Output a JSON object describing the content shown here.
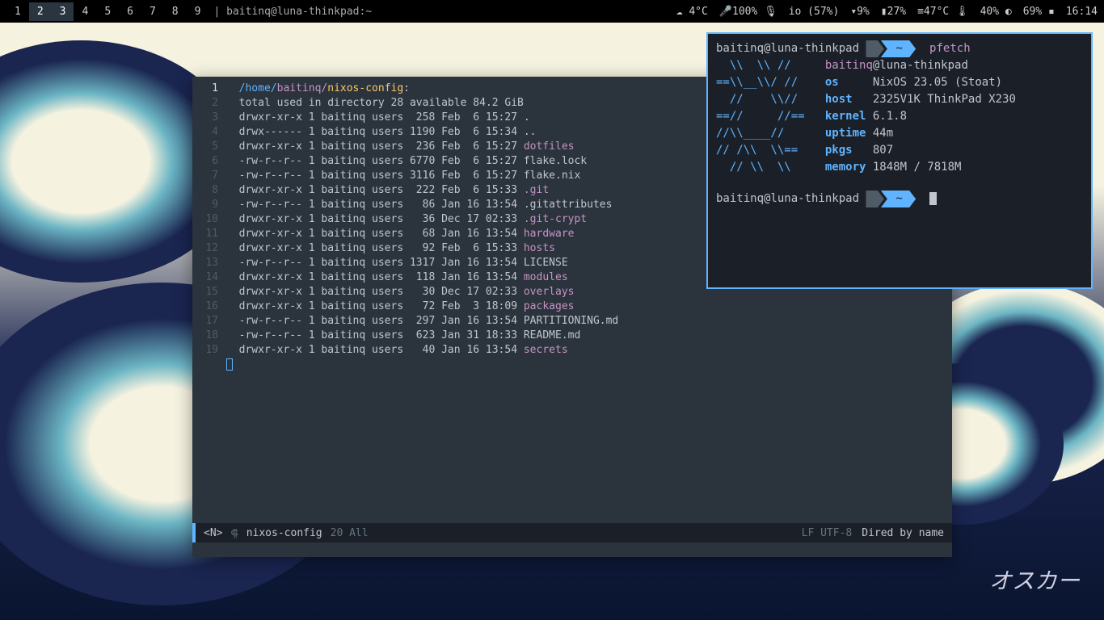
{
  "statusbar": {
    "workspaces": [
      "1",
      "2",
      "3",
      "4",
      "5",
      "6",
      "7",
      "8",
      "9"
    ],
    "active_workspaces": [
      1,
      2
    ],
    "title_prefix": "| ",
    "title": "baitinq@luna-thinkpad:~",
    "weather_icon": "☁",
    "weather": "4°C",
    "mic_icon": "🎤",
    "mic": "100%",
    "io_label": "io (57%)",
    "net_down": "▾9%",
    "bat1": "▮27%",
    "temp": "≡47°C 🌡",
    "bat2": "40% ◐",
    "bat3": "69% ▪",
    "time": "16:14"
  },
  "editor": {
    "path_root": "/home/",
    "path_mid": "baitinq/",
    "path_tail": "nixos-config",
    "path_colon": ":",
    "header_tail": "total used in directory 28 available 84.2 GiB",
    "rows": [
      {
        "ln": "1"
      },
      {
        "ln": "2"
      },
      {
        "ln": "3",
        "perm": "drwxr-xr-x 1 baitinq users  258 Feb  6 15:27 ",
        "name": ".",
        "cls": "file-normal"
      },
      {
        "ln": "4",
        "perm": "drwx------ 1 baitinq users 1190 Feb  6 15:34 ",
        "name": "..",
        "cls": "file-normal"
      },
      {
        "ln": "5",
        "perm": "drwxr-xr-x 1 baitinq users  236 Feb  6 15:27 ",
        "name": "dotfiles",
        "cls": "dir-name"
      },
      {
        "ln": "6",
        "perm": "-rw-r--r-- 1 baitinq users 6770 Feb  6 15:27 ",
        "name": "flake.lock",
        "cls": "file-normal"
      },
      {
        "ln": "7",
        "perm": "-rw-r--r-- 1 baitinq users 3116 Feb  6 15:27 ",
        "name": "flake.nix",
        "cls": "file-normal"
      },
      {
        "ln": "8",
        "perm": "drwxr-xr-x 1 baitinq users  222 Feb  6 15:33 ",
        "name": ".git",
        "cls": "dir-name"
      },
      {
        "ln": "9",
        "perm": "-rw-r--r-- 1 baitinq users   86 Jan 16 13:54 ",
        "name": ".gitattributes",
        "cls": "file-normal"
      },
      {
        "ln": "10",
        "perm": "drwxr-xr-x 1 baitinq users   36 Dec 17 02:33 ",
        "name": ".git-crypt",
        "cls": "dir-name"
      },
      {
        "ln": "11",
        "perm": "drwxr-xr-x 1 baitinq users   68 Jan 16 13:54 ",
        "name": "hardware",
        "cls": "dir-name"
      },
      {
        "ln": "12",
        "perm": "drwxr-xr-x 1 baitinq users   92 Feb  6 15:33 ",
        "name": "hosts",
        "cls": "dir-name"
      },
      {
        "ln": "13",
        "perm": "-rw-r--r-- 1 baitinq users 1317 Jan 16 13:54 ",
        "name": "LICENSE",
        "cls": "file-normal"
      },
      {
        "ln": "14",
        "perm": "drwxr-xr-x 1 baitinq users  118 Jan 16 13:54 ",
        "name": "modules",
        "cls": "dir-name"
      },
      {
        "ln": "15",
        "perm": "drwxr-xr-x 1 baitinq users   30 Dec 17 02:33 ",
        "name": "overlays",
        "cls": "dir-name"
      },
      {
        "ln": "16",
        "perm": "drwxr-xr-x 1 baitinq users   72 Feb  3 18:09 ",
        "name": "packages",
        "cls": "dir-name"
      },
      {
        "ln": "17",
        "perm": "-rw-r--r-- 1 baitinq users  297 Jan 16 13:54 ",
        "name": "PARTITIONING.md",
        "cls": "file-normal"
      },
      {
        "ln": "18",
        "perm": "-rw-r--r-- 1 baitinq users  623 Jan 31 18:33 ",
        "name": "README.md",
        "cls": "file-normal"
      },
      {
        "ln": "19",
        "perm": "drwxr-xr-x 1 baitinq users   40 Jan 16 13:54 ",
        "name": "secrets",
        "cls": "dir-name"
      }
    ],
    "modeline": {
      "state": "<N>",
      "icon": "⸿",
      "buffer": "nixos-config",
      "pos": "20 All",
      "encoding": "LF UTF-8",
      "mode": "Dired by name"
    }
  },
  "terminal": {
    "prompt_user": "baitinq@luna-thinkpad",
    "prompt_dir": "~",
    "command": "pfetch",
    "logo": [
      "  \\\\  \\\\ //   ",
      "==\\\\__\\\\/ //  ",
      "  //    \\\\//  ",
      "==//     //== ",
      "//\\\\____//    ",
      "// /\\\\  \\\\==  ",
      "  // \\\\  \\\\   "
    ],
    "info": {
      "user": "baitinq",
      "at": "@",
      "host": "luna-thinkpad",
      "os_k": "os    ",
      "os_v": "NixOS 23.05 (Stoat)",
      "host_k": "host  ",
      "host_v": "2325V1K ThinkPad X230",
      "kernel_k": "kernel",
      "kernel_v": "6.1.8",
      "uptime_k": "uptime",
      "uptime_v": "44m",
      "pkgs_k": "pkgs  ",
      "pkgs_v": "807",
      "memory_k": "memory",
      "memory_v": "1848M / 7818M"
    }
  },
  "signature": "オスカー"
}
